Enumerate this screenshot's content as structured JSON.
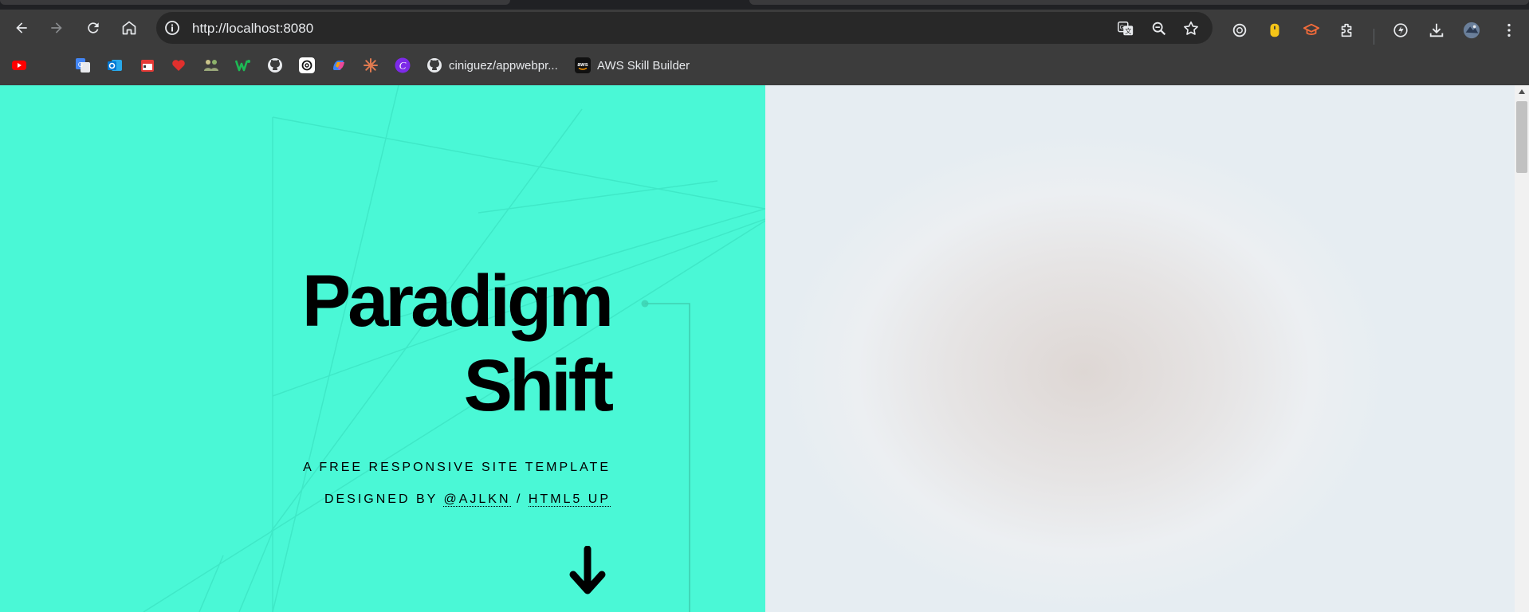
{
  "browser": {
    "url": "http://localhost:8080",
    "bookmarks": [
      {
        "icon": "youtube-icon",
        "label": ""
      },
      {
        "icon": "google-translate-icon",
        "label": ""
      },
      {
        "icon": "outlook-icon",
        "label": ""
      },
      {
        "icon": "calendar-app-icon",
        "label": ""
      },
      {
        "icon": "heart-app-icon",
        "label": ""
      },
      {
        "icon": "people-app-icon",
        "label": ""
      },
      {
        "icon": "w-app-icon",
        "label": ""
      },
      {
        "icon": "github-icon",
        "label": ""
      },
      {
        "icon": "openai-icon",
        "label": ""
      },
      {
        "icon": "copilot-icon",
        "label": ""
      },
      {
        "icon": "claude-icon",
        "label": ""
      },
      {
        "icon": "canva-icon",
        "label": ""
      },
      {
        "icon": "github-icon",
        "label": "ciniguez/appwebpr..."
      },
      {
        "icon": "aws-icon",
        "label": "AWS Skill Builder"
      }
    ]
  },
  "hero": {
    "title_line1": "Paradigm",
    "title_line2": "Shift",
    "tagline": "A FREE RESPONSIVE SITE TEMPLATE",
    "designed_by": "DESIGNED BY",
    "author_link": "@AJLKN",
    "separator": "/",
    "html5up_link": "HTML5 UP"
  },
  "colors": {
    "hero_bg": "#4af8d6",
    "chrome_toolbar": "#3c3c3c",
    "omnibox": "#282828"
  }
}
